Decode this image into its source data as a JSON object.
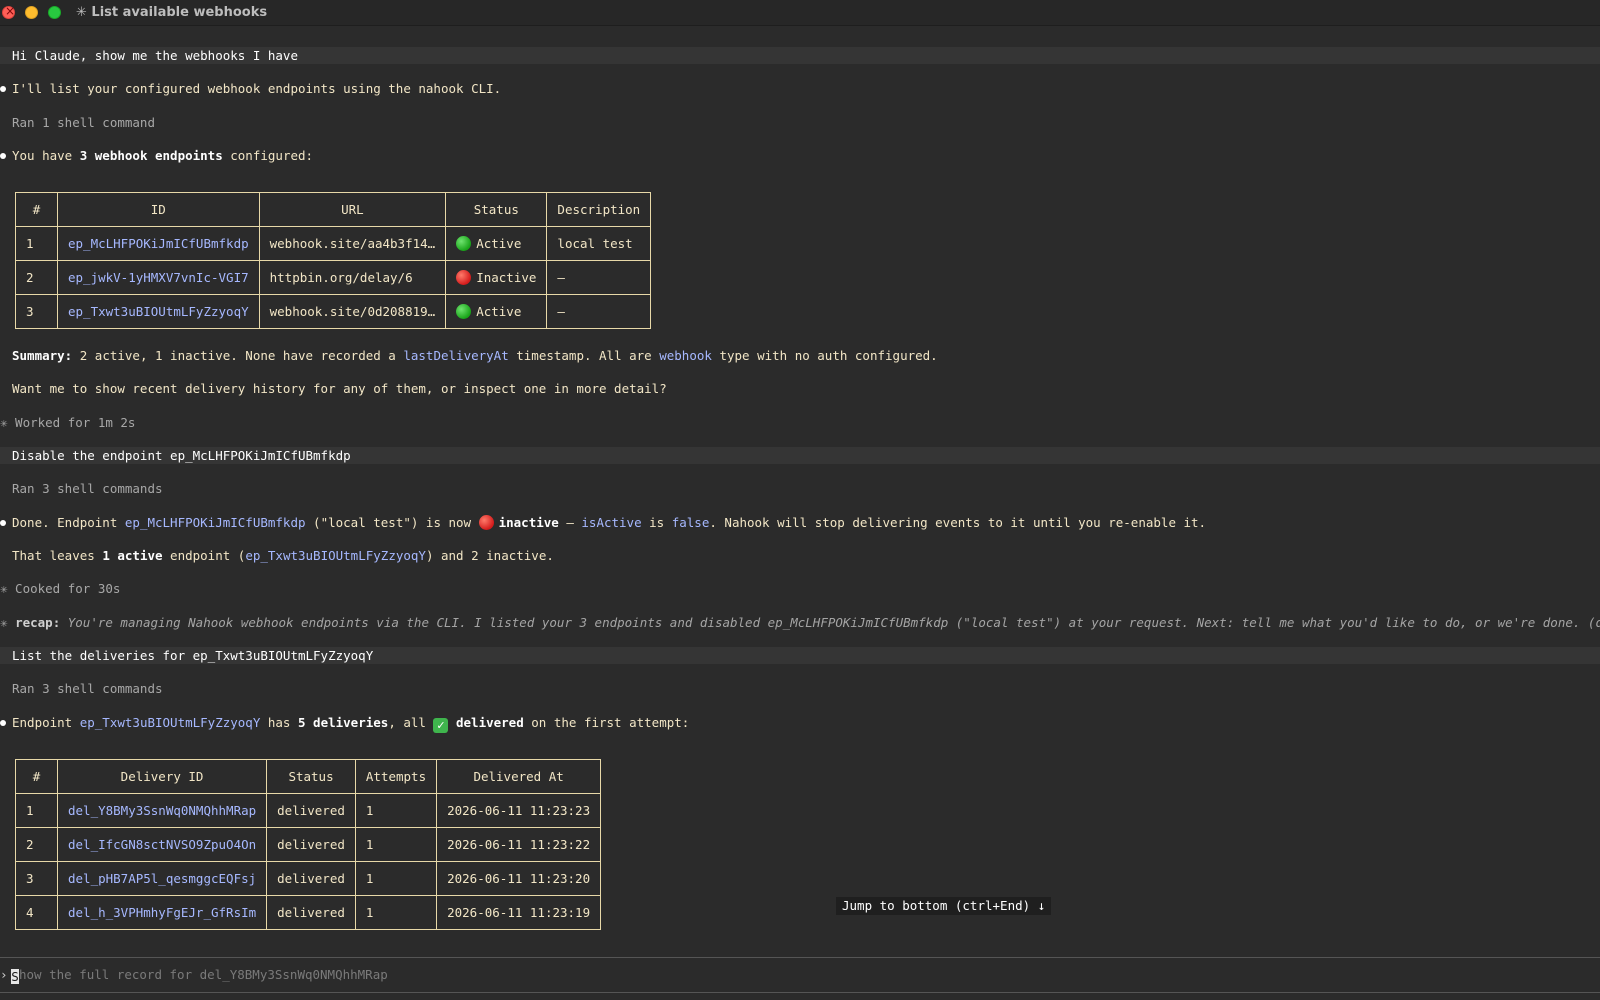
{
  "window": {
    "title": "✳ List available webhooks"
  },
  "messages": {
    "m1_user": "Hi Claude, show me the webhooks I have",
    "m2": "I'll list your configured webhook endpoints using the nahook CLI.",
    "m3_ran": "Ran 1 shell command",
    "m4_a": "You have ",
    "m4_b": "3 webhook endpoints",
    "m4_c": " configured:",
    "summary_label": "Summary:",
    "summary_a": " 2 active, 1 inactive. None have recorded a ",
    "summary_code1": "lastDeliveryAt",
    "summary_b": " timestamp. All are ",
    "summary_code2": "webhook",
    "summary_c": " type with no auth configured.",
    "want": "Want me to show recent delivery history for any of them, or inspect one in more detail?",
    "worked": "✳ Worked for 1m 2s",
    "user2": "Disable the endpoint ep_McLHFPOKiJmICfUBmfkdp",
    "ran3a": "Ran 3 shell commands",
    "done_a": "Done. Endpoint ",
    "done_code": "ep_McLHFPOKiJmICfUBmfkdp",
    "done_b": " (\"local test\") is now ",
    "done_bold": "inactive",
    "done_dash": " — ",
    "done_code2": "isActive",
    "done_is": " is ",
    "done_code3": "false",
    "done_c": ". Nahook will stop delivering events to it until you re-enable it.",
    "leaves_a": "That leaves ",
    "leaves_bold": "1 active",
    "leaves_b": " endpoint (",
    "leaves_code": "ep_Txwt3uBIOUtmLFyZzyoqY",
    "leaves_c": ") and 2 inactive.",
    "cooked": "✳ Cooked for 30s",
    "recap_star": "✳",
    "recap_label": "recap:",
    "recap_text": "You're managing Nahook webhook endpoints via the CLI. I listed your 3 endpoints and disabled ep_McLHFPOKiJmICfUBmfkdp (\"local test\") at your request. Next: tell me what you'd like to do, or we're done. (disable recaps in",
    "user3": "List the deliveries for ep_Txwt3uBIOUtmLFyZzyoqY",
    "ran3b": "Ran 3 shell commands",
    "del_a": "Endpoint ",
    "del_code": "ep_Txwt3uBIOUtmLFyZzyoqY",
    "del_b": " has ",
    "del_bold1": "5 deliveries",
    "del_c": ", all ",
    "del_check": "✓",
    "del_bold2": "delivered",
    "del_d": " on the first attempt:"
  },
  "endpoints_table": {
    "headers": [
      "#",
      "ID",
      "URL",
      "Status",
      "Description"
    ],
    "rows": [
      {
        "n": "1",
        "id": "ep_McLHFPOKiJmICfUBmfkdp",
        "url": "webhook.site/aa4b3f14…",
        "status": "Active",
        "status_color": "green",
        "desc": "local test"
      },
      {
        "n": "2",
        "id": "ep_jwkV-1yHMXV7vnIc-VGI7",
        "url": "httpbin.org/delay/6",
        "status": "Inactive",
        "status_color": "red",
        "desc": "—"
      },
      {
        "n": "3",
        "id": "ep_Txwt3uBIOUtmLFyZzyoqY",
        "url": "webhook.site/0d208819…",
        "status": "Active",
        "status_color": "green",
        "desc": "—"
      }
    ]
  },
  "deliveries_table": {
    "headers": [
      "#",
      "Delivery ID",
      "Status",
      "Attempts",
      "Delivered At"
    ],
    "rows": [
      {
        "n": "1",
        "id": "del_Y8BMy3SsnWq0NMQhhMRap",
        "status": "delivered",
        "attempts": "1",
        "at": "2026-06-11 11:23:23"
      },
      {
        "n": "2",
        "id": "del_IfcGN8sctNVSO9ZpuO4On",
        "status": "delivered",
        "attempts": "1",
        "at": "2026-06-11 11:23:22"
      },
      {
        "n": "3",
        "id": "del_pHB7AP5l_qesmggcEQFsj",
        "status": "delivered",
        "attempts": "1",
        "at": "2026-06-11 11:23:20"
      },
      {
        "n": "4",
        "id": "del_h_3VPHmhyFgEJr_GfRsIm",
        "status": "delivered",
        "attempts": "1",
        "at": "2026-06-11 11:23:19"
      }
    ]
  },
  "jump_button": "Jump to bottom (ctrl+End) ↓",
  "input": {
    "prompt": "›",
    "cursor_char": "S",
    "text": "how the full record for del_Y8BMy3SsnWq0NMQhhMRap"
  },
  "colors": {
    "background": "#2b2b2b",
    "text": "#f2e6c6",
    "code": "#a6b8ff",
    "user_bar": "#353535"
  }
}
